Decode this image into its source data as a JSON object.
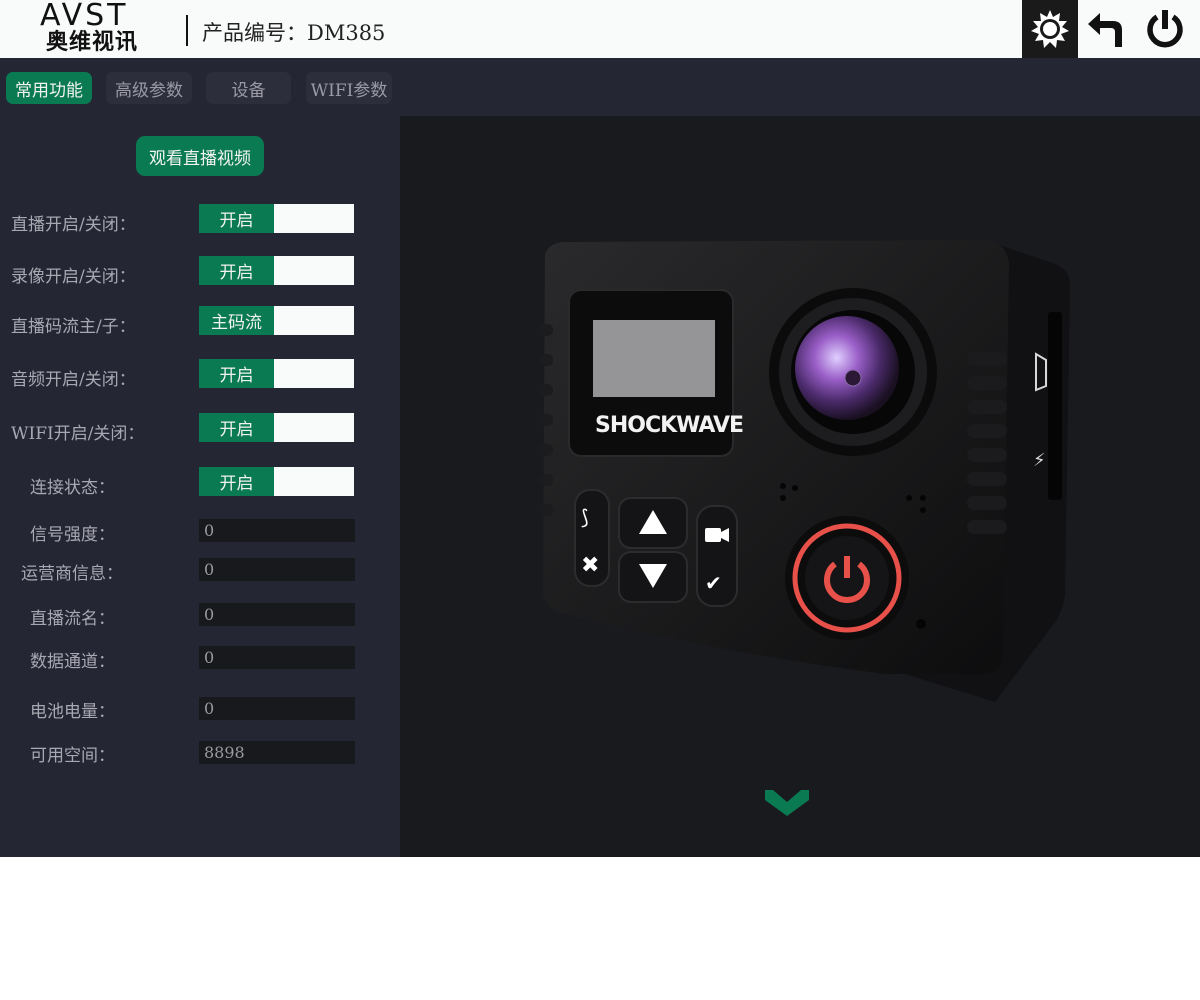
{
  "header": {
    "logo_top": "AVST",
    "logo_bottom": "奥维视讯",
    "product_label": "产品编号：DM385"
  },
  "icons": {
    "settings": "gear-icon",
    "back": "back-arrow-icon",
    "power": "power-icon",
    "scroll_down": "chevron-down-icon"
  },
  "tabs": [
    {
      "label": "常用功能",
      "active": true
    },
    {
      "label": "高级参数",
      "active": false
    },
    {
      "label": "设备",
      "active": false
    },
    {
      "label": "WIFI参数",
      "active": false
    }
  ],
  "panel": {
    "live_button": "观看直播视频",
    "toggles": [
      {
        "label": "直播开启/关闭：",
        "value": "开启"
      },
      {
        "label": "录像开启/关闭：",
        "value": "开启"
      },
      {
        "label": "直播码流主/子：",
        "value": "主码流"
      },
      {
        "label": "音频开启/关闭：",
        "value": "开启"
      },
      {
        "label": "WIFI开启/关闭：",
        "value": "开启"
      },
      {
        "label": "连接状态：",
        "value": "开启"
      }
    ],
    "fields": [
      {
        "label": "信号强度：",
        "value": "0"
      },
      {
        "label": "运营商信息：",
        "value": "0"
      },
      {
        "label": "直播流名：",
        "value": "0"
      },
      {
        "label": "数据通道：",
        "value": "0"
      },
      {
        "label": "电池电量：",
        "value": "0"
      },
      {
        "label": "可用空间：",
        "value": "8898"
      }
    ]
  },
  "camera": {
    "brand": "SHOCKWAVE"
  },
  "colors": {
    "accent": "#0a7a52",
    "panel_bg": "#252634",
    "dark_bg": "#181a1d",
    "power_ring": "#e8504a"
  }
}
